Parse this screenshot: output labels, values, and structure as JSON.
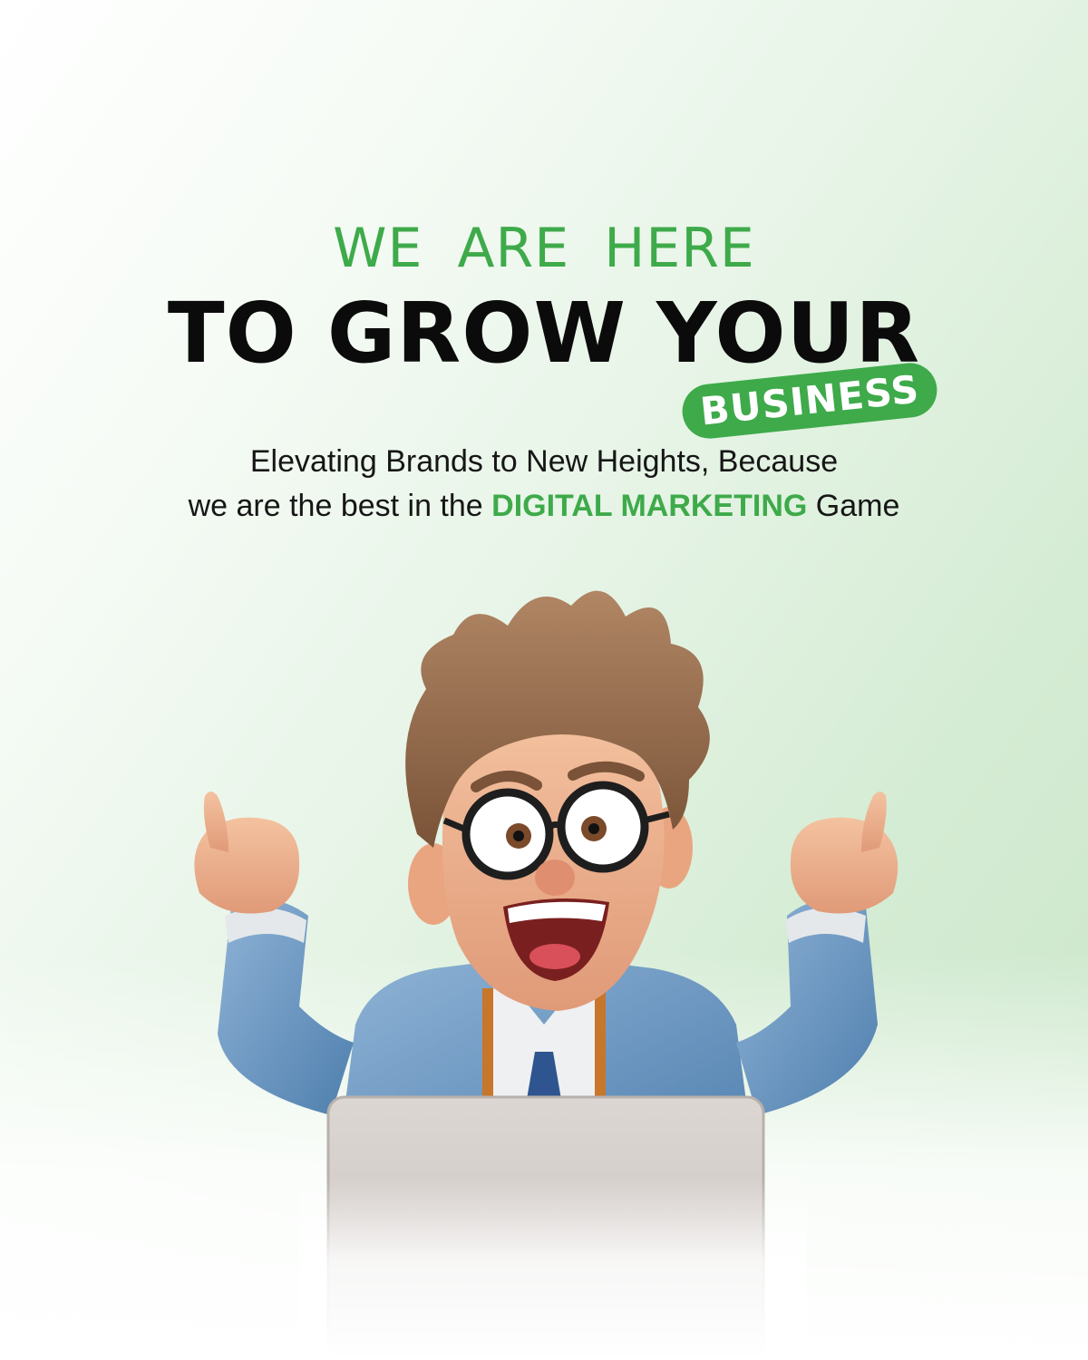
{
  "headline": {
    "kicker": "WE  ARE HERE",
    "main": "TO GROW YOUR",
    "badge": "BUSINESS"
  },
  "tagline": {
    "line1": "Elevating Brands to New Heights, Because",
    "line2_prefix": "we are the best in the ",
    "line2_highlight": "DIGITAL  MARKETING",
    "line2_suffix": " Game"
  },
  "colors": {
    "accent": "#3eaa4a",
    "headline": "#0b0b0b",
    "body_text": "#161616",
    "background_light": "#ffffff",
    "background_green": "#c9e6c8"
  },
  "illustration": {
    "icon": "excited-man-with-laptop-illustration"
  }
}
